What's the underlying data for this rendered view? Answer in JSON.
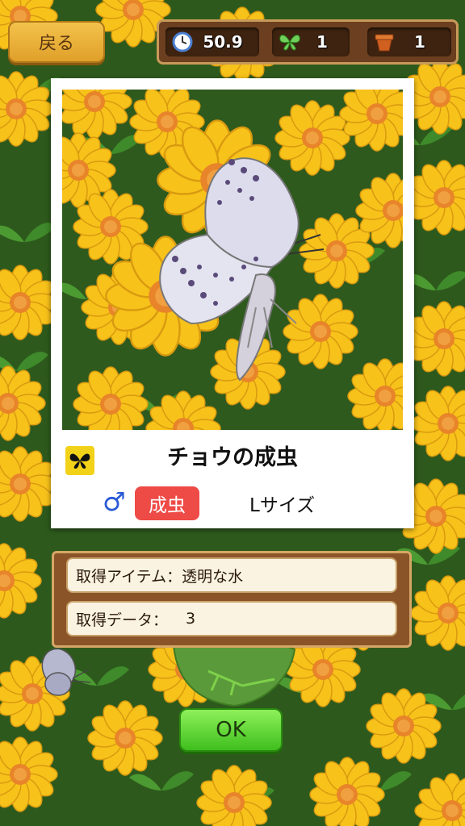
{
  "header": {
    "back_label": "戻る",
    "time_value": "50.9",
    "butterfly_count": "1",
    "pot_count": "1"
  },
  "card": {
    "title": "チョウの成虫",
    "sex_symbol": "♂",
    "stage_label": "成虫",
    "size_label": "Lサイズ"
  },
  "info": {
    "item_label": "取得アイテム：",
    "item_value": "透明な水",
    "data_label": "取得データ：",
    "data_value": "3"
  },
  "ok_label": "OK",
  "icons": [
    "clock-icon",
    "butterfly-icon",
    "flowerpot-icon",
    "butterfly-type-icon"
  ],
  "colors": {
    "badge_red": "#ee4a46",
    "ok_green": "#3fbf1e",
    "wood_brown": "#6b3f1f",
    "type_yellow": "#f2d219"
  }
}
